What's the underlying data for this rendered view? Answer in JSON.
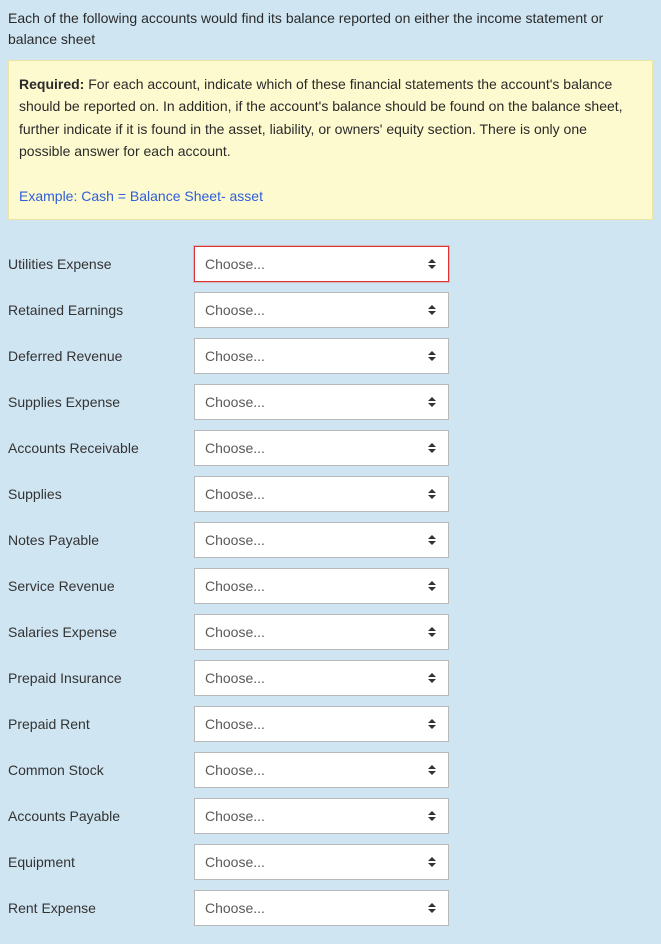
{
  "intro": "Each of the following accounts would find its balance reported on either the income statement or balance sheet",
  "required": {
    "label": "Required:",
    "text": " For each account, indicate which of these financial statements the account's balance should be reported on. In addition, if the account's balance should be found on the balance sheet, further indicate if it is found in the asset, liability, or owners' equity section. There is only one possible answer for each account.",
    "example": "Example: Cash = Balance Sheet- asset"
  },
  "placeholder": "Choose...",
  "accounts": [
    {
      "label": "Utilities Expense",
      "highlighted": true
    },
    {
      "label": "Retained Earnings",
      "highlighted": false
    },
    {
      "label": "Deferred Revenue",
      "highlighted": false
    },
    {
      "label": "Supplies Expense",
      "highlighted": false
    },
    {
      "label": "Accounts Receivable",
      "highlighted": false
    },
    {
      "label": "Supplies",
      "highlighted": false
    },
    {
      "label": "Notes Payable",
      "highlighted": false
    },
    {
      "label": "Service Revenue",
      "highlighted": false
    },
    {
      "label": "Salaries Expense",
      "highlighted": false
    },
    {
      "label": "Prepaid Insurance",
      "highlighted": false
    },
    {
      "label": "Prepaid Rent",
      "highlighted": false
    },
    {
      "label": "Common Stock",
      "highlighted": false
    },
    {
      "label": "Accounts Payable",
      "highlighted": false
    },
    {
      "label": "Equipment",
      "highlighted": false
    },
    {
      "label": "Rent Expense",
      "highlighted": false
    }
  ]
}
